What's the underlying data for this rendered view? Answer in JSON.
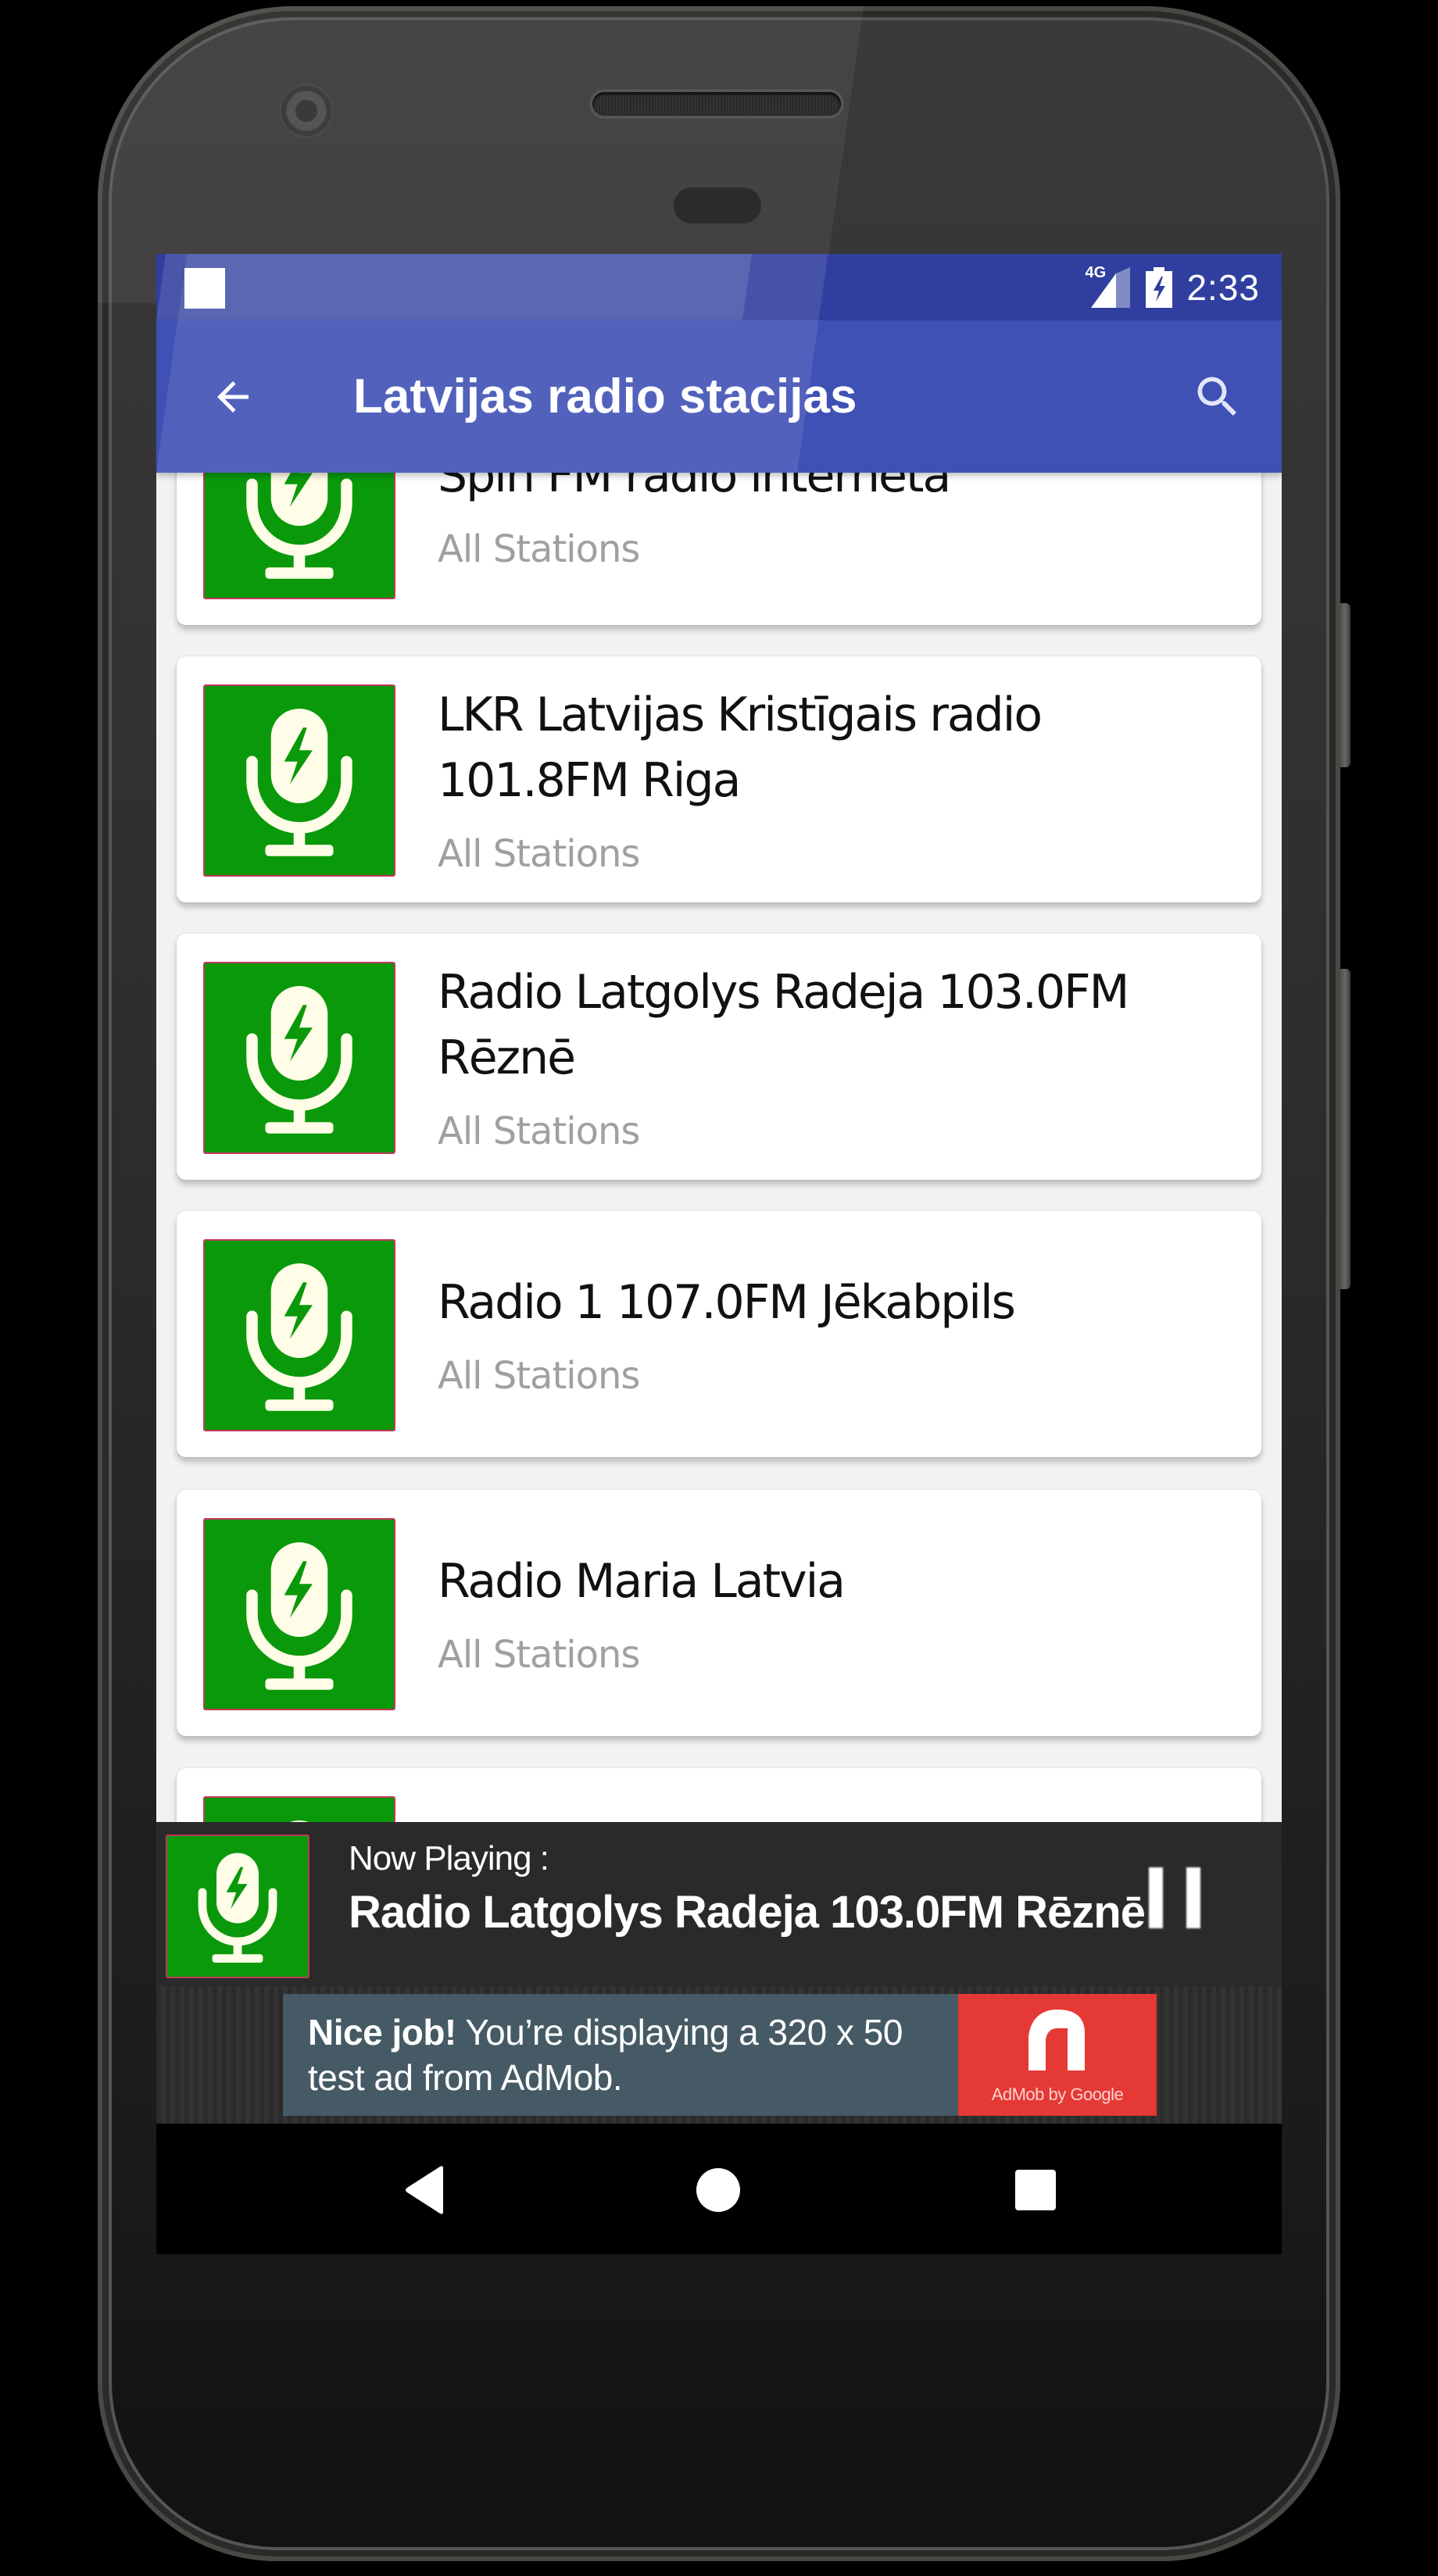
{
  "status_bar": {
    "network_label": "4G",
    "time": "2:33",
    "icons": [
      "notification-square-icon",
      "signal-4g-icon",
      "battery-charging-icon"
    ]
  },
  "app_bar": {
    "title": "Latvijas radio stacijas",
    "back_icon": "arrow-back-icon",
    "search_icon": "search-icon"
  },
  "stations": [
    {
      "title": "Spin FM radio internetā",
      "subtitle": "All Stations",
      "icon": "microphone-icon"
    },
    {
      "title": "LKR Latvijas Kristīgais radio 101.8FM Riga",
      "subtitle": "All Stations",
      "icon": "microphone-icon"
    },
    {
      "title": "Radio Latgolys Radeja 103.0FM Rēznē",
      "subtitle": "All Stations",
      "icon": "microphone-icon"
    },
    {
      "title": "Radio 1 107.0FM Jēkabpils",
      "subtitle": "All Stations",
      "icon": "microphone-icon"
    },
    {
      "title": "Radio Maria Latvia",
      "subtitle": "All Stations",
      "icon": "microphone-icon"
    },
    {
      "title": "",
      "subtitle": "",
      "icon": "microphone-icon"
    }
  ],
  "now_playing": {
    "label": "Now Playing :",
    "title": "Radio Latgolys Radeja 103.0FM Rēznē",
    "control_icon": "pause-icon"
  },
  "ad_banner": {
    "bold": "Nice job!",
    "text": " You’re displaying a 320 x 50 test ad from AdMob.",
    "logo_caption": "AdMob by Google"
  },
  "nav_bar": {
    "back_icon": "nav-back-icon",
    "home_icon": "nav-home-icon",
    "recents_icon": "nav-recents-icon"
  },
  "colors": {
    "primary": "#3f51b5",
    "primary_dark": "#303f9f",
    "station_icon_bg": "#0a990a",
    "now_playing_bg": "#2a2a2a",
    "ad_bg": "#455a64",
    "admob_red": "#e53935"
  }
}
